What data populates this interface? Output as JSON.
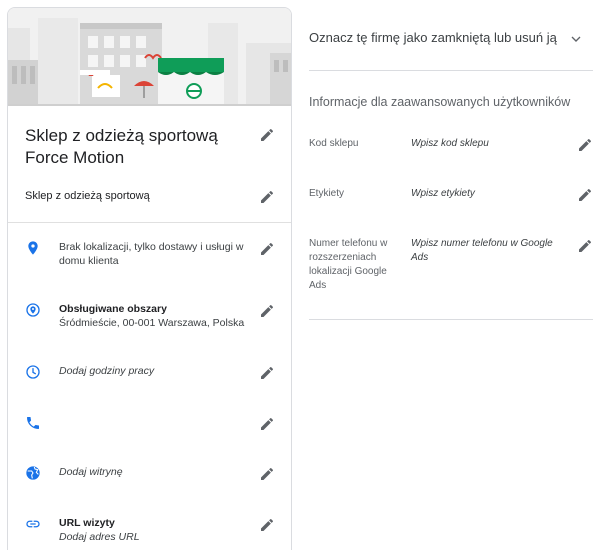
{
  "card": {
    "business_name": "Sklep z odzieżą sportową Force Motion",
    "category": "Sklep z odzieżą sportową",
    "rows": [
      {
        "icon": "location-pin-icon",
        "title": "",
        "text": "Brak lokalizacji, tylko dostawy i usługi w domu klienta"
      },
      {
        "icon": "service-area-icon",
        "title": "Obsługiwane obszary",
        "text": "Śródmieście, 00-001 Warszawa, Polska"
      },
      {
        "icon": "clock-icon",
        "title": "",
        "text": "Dodaj godziny pracy"
      },
      {
        "icon": "phone-icon",
        "title": "",
        "text": ""
      },
      {
        "icon": "globe-icon",
        "title": "",
        "text": "Dodaj witrynę"
      },
      {
        "icon": "link-icon",
        "title": "URL wizyty",
        "text": "Dodaj adres URL"
      }
    ]
  },
  "right": {
    "close_label": "Oznacz tę firmę jako zamkniętą lub usuń ją",
    "advanced_title": "Informacje dla zaawansowanych użytkowników",
    "advanced": [
      {
        "label": "Kod sklepu",
        "value": "Wpisz kod sklepu"
      },
      {
        "label": "Etykiety",
        "value": "Wpisz etykiety"
      },
      {
        "label": "Numer telefonu w rozszerzeniach lokalizacji Google Ads",
        "value": "Wpisz numer telefonu w Google Ads"
      }
    ]
  },
  "colors": {
    "accent_blue": "#1a73e8",
    "icon_grey": "#5f6368",
    "divider": "#dadce0"
  }
}
